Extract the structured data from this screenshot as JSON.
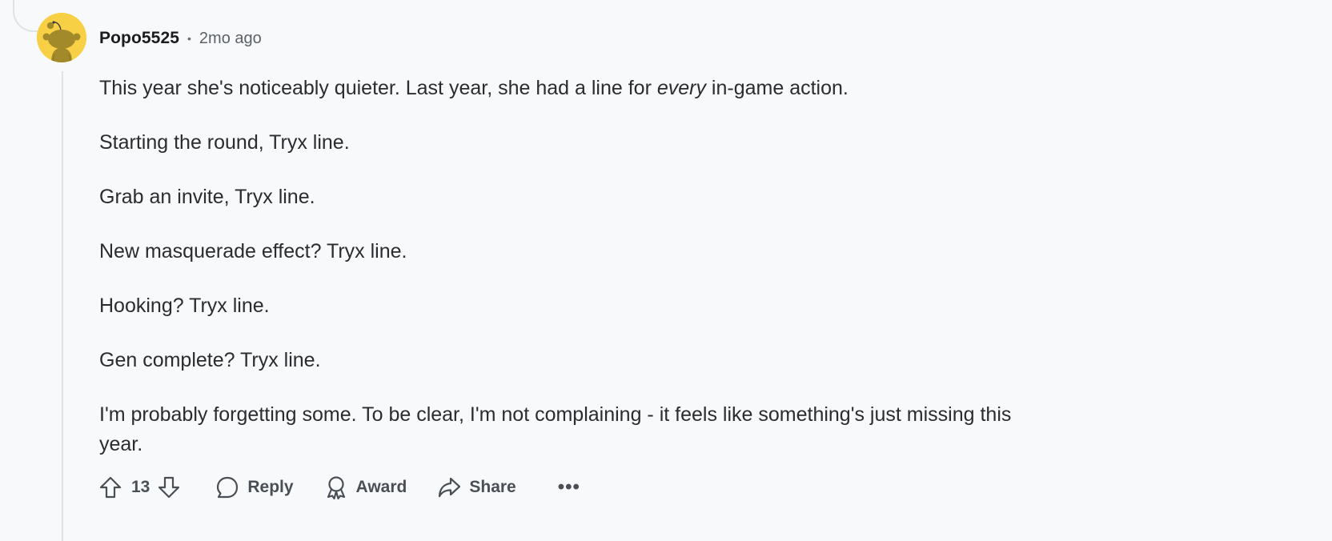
{
  "colors": {
    "background": "#f8f9fb",
    "avatar_bg": "#f7d046",
    "thread_line": "#dfe3e8",
    "action_text": "#4a4f55"
  },
  "comment": {
    "author": "Popo5525",
    "separator": "•",
    "timestamp": "2mo ago",
    "paragraphs": {
      "p1_before": "This year she's noticeably quieter. Last year, she had a line for ",
      "p1_emphasis": "every",
      "p1_after": " in-game action.",
      "p2": "Starting the round, Tryx line.",
      "p3": "Grab an invite, Tryx line.",
      "p4": "New masquerade effect? Tryx line.",
      "p5": "Hooking? Tryx line.",
      "p6": "Gen complete? Tryx line.",
      "p7": "I'm probably forgetting some. To be clear, I'm not complaining - it feels like something's just missing this year."
    }
  },
  "actions": {
    "upvote_icon": "arrow-up-outline-icon",
    "vote_count": "13",
    "downvote_icon": "arrow-down-outline-icon",
    "reply_label": "Reply",
    "reply_icon": "speech-bubble-icon",
    "award_label": "Award",
    "award_icon": "ribbon-award-icon",
    "share_label": "Share",
    "share_icon": "share-arrow-icon",
    "more_label": "•••"
  }
}
